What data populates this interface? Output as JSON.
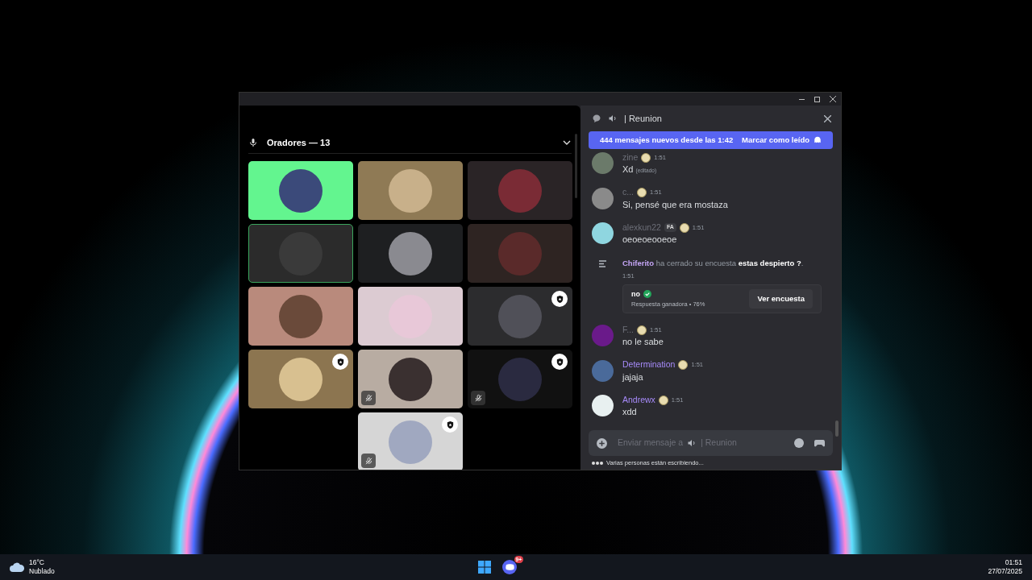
{
  "voice": {
    "section_title": "Oradores — 13",
    "tiles": [
      {
        "color": "#63f58f",
        "speaking": false,
        "moderator": false,
        "muted": false
      },
      {
        "color": "#8f7a55",
        "speaking": false,
        "moderator": false,
        "muted": false
      },
      {
        "color": "#2a2426",
        "speaking": false,
        "moderator": false,
        "muted": false
      },
      {
        "color": "#2b2b2b",
        "speaking": true,
        "moderator": false,
        "muted": false
      },
      {
        "color": "#1e1f21",
        "speaking": false,
        "moderator": false,
        "muted": false
      },
      {
        "color": "#2e2422",
        "speaking": false,
        "moderator": false,
        "muted": false
      },
      {
        "color": "#b98a7c",
        "speaking": false,
        "moderator": false,
        "muted": false
      },
      {
        "color": "#dccbd2",
        "speaking": false,
        "moderator": false,
        "muted": false
      },
      {
        "color": "#2c2c2e",
        "speaking": false,
        "moderator": true,
        "muted": false
      },
      {
        "color": "#8c7550",
        "speaking": false,
        "moderator": true,
        "muted": false
      },
      {
        "color": "#b8aca2",
        "speaking": false,
        "moderator": false,
        "muted": true
      },
      {
        "color": "#111111",
        "speaking": false,
        "moderator": true,
        "muted": true
      },
      {
        "color": "#d6d6d6",
        "speaking": false,
        "moderator": true,
        "muted": true
      }
    ]
  },
  "chat": {
    "channel": "| Reunion",
    "banner": {
      "text": "444 mensajes nuevos desde las 1:42",
      "action": "Marcar como leído"
    },
    "messages": [
      {
        "kind": "message",
        "author": "zine",
        "color": "#6d6f78",
        "time": "1:51",
        "text": "Xd",
        "edited": "(editado)"
      },
      {
        "kind": "message",
        "author": "c...",
        "color": "#6d6f78",
        "time": "1:51",
        "text": "Si, pensé que era mostaza"
      },
      {
        "kind": "message",
        "author": "alexkun22",
        "color": "#6d6f78",
        "tag": "FA",
        "time": "1:51",
        "text": "oeoeoeooeoe"
      },
      {
        "kind": "poll",
        "text": "**Chiferito** ha cerrado su encuesta **estas despierto ?**.",
        "time": "1:51",
        "answer": "no",
        "result": "Respuesta ganadora • 76%",
        "button": "Ver encuesta"
      },
      {
        "kind": "message",
        "author": "F...",
        "color": "#6d6f78",
        "time": "1:51",
        "text": "no le sabe"
      },
      {
        "kind": "message",
        "author": "Determination",
        "color": "#a78bfa",
        "time": "1:51",
        "text": "jajaja"
      },
      {
        "kind": "message",
        "author": "Andrewx",
        "color": "#a78bfa",
        "time": "1:51",
        "text": "xdd"
      }
    ],
    "input": {
      "placeholder_start": "Enviar mensaje a",
      "placeholder_end": "| Reunion"
    },
    "typing": "Varias personas están escribiendo..."
  },
  "taskbar": {
    "temperature": "16°C",
    "weather": "Nublado",
    "discord_badge": "9+",
    "time": "01:51",
    "date": "27/07/2025"
  }
}
